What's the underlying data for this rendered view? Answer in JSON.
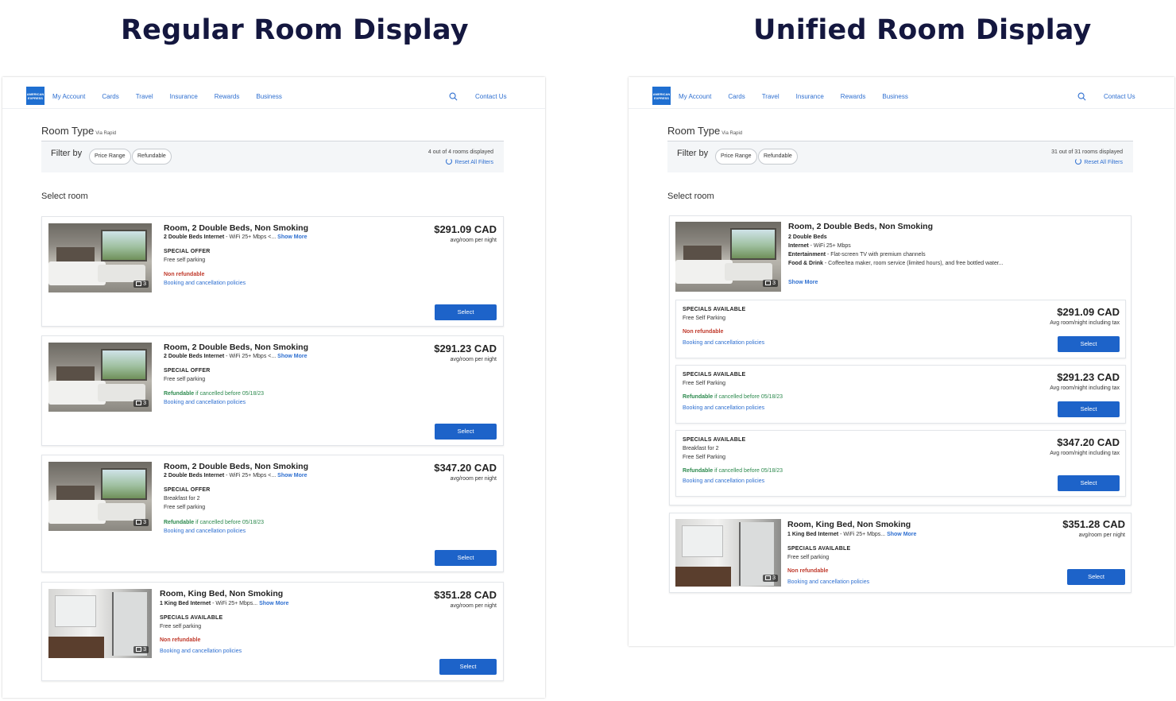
{
  "headings": {
    "left": "Regular Room Display",
    "right": "Unified Room Display"
  },
  "nav": {
    "logo_text": "AMERICAN EXPRESS",
    "links": [
      "My Account",
      "Cards",
      "Travel",
      "Insurance",
      "Rewards",
      "Business"
    ],
    "contact": "Contact Us"
  },
  "page": {
    "room_type": "Room Type",
    "via": "Via Rapid",
    "filter_by": "Filter by",
    "chips": [
      "Price Range",
      "Refundable"
    ],
    "reset": "Reset All Filters",
    "select_room": "Select room"
  },
  "regular": {
    "count": "4 out of 4 rooms displayed",
    "rooms": [
      {
        "title": "Room, 2 Double Beds, Non Smoking",
        "bed": "2 Double Beds Internet",
        "wifi": " - WiFi 25+ Mbps <...",
        "show_more": "Show More",
        "offer_label": "SPECIAL OFFER",
        "perks": [
          "Free self parking"
        ],
        "refund_bold": "Non refundable",
        "refund_rest": "",
        "policy": "Booking and cancellation policies",
        "price": "$291.09 CAD",
        "per": "avg/room per night",
        "button": "Select",
        "photos": "3"
      },
      {
        "title": "Room, 2 Double Beds, Non Smoking",
        "bed": "2 Double Beds Internet",
        "wifi": " - WiFi 25+ Mbps <...",
        "show_more": "Show More",
        "offer_label": "SPECIAL OFFER",
        "perks": [
          "Free self parking"
        ],
        "refund_bold": "Refundable",
        "refund_rest": " if cancelled before 05/18/23",
        "policy": "Booking and cancellation policies",
        "price": "$291.23 CAD",
        "per": "avg/room per night",
        "button": "Select",
        "photos": "3"
      },
      {
        "title": "Room, 2 Double Beds, Non Smoking",
        "bed": "2 Double Beds Internet",
        "wifi": " - WiFi 25+ Mbps <...",
        "show_more": "Show More",
        "offer_label": "SPECIAL OFFER",
        "perks": [
          "Breakfast for 2",
          "Free self parking"
        ],
        "refund_bold": "Refundable",
        "refund_rest": " if cancelled before 05/18/23",
        "policy": "Booking and cancellation policies",
        "price": "$347.20 CAD",
        "per": "avg/room per night",
        "button": "Select",
        "photos": "3"
      },
      {
        "title": "Room, King Bed, Non Smoking",
        "bed": "1 King Bed Internet",
        "wifi": " - WiFi 25+ Mbps...",
        "show_more": "Show More",
        "offer_label": "SPECIALS AVAILABLE",
        "perks": [
          "Free self parking"
        ],
        "refund_bold": "Non refundable",
        "refund_rest": "",
        "policy": "Booking and cancellation policies",
        "price": "$351.28 CAD",
        "per": "avg/room per night",
        "button": "Select",
        "photos": "3"
      }
    ]
  },
  "unified": {
    "count": "31 out of 31 rooms displayed",
    "group": {
      "title": "Room, 2 Double Beds, Non Smoking",
      "beds": "2 Double Beds",
      "internet_label": "Internet",
      "internet": " - WiFi 25+ Mbps",
      "entertainment_label": "Entertainment",
      "entertainment": " - Flat-screen TV with premium channels",
      "food_label": "Food & Drink",
      "food": " - Coffee/tea maker, room service (limited hours), and free bottled water...",
      "show_more": "Show More",
      "photos": "3",
      "offers": [
        {
          "label": "SPECIALS AVAILABLE",
          "perks": [
            "Free Self Parking"
          ],
          "refund_bold": "Non refundable",
          "refund_rest": "",
          "policy": "Booking and cancellation policies",
          "price": "$291.09 CAD",
          "per": "Avg room/night including tax",
          "button": "Select"
        },
        {
          "label": "SPECIALS AVAILABLE",
          "perks": [
            "Free Self Parking"
          ],
          "refund_bold": "Refundable",
          "refund_rest": " if cancelled before 05/18/23",
          "policy": "Booking and cancellation policies",
          "price": "$291.23 CAD",
          "per": "Avg room/night including tax",
          "button": "Select"
        },
        {
          "label": "SPECIALS AVAILABLE",
          "perks": [
            "Breakfast for 2",
            "Free Self Parking"
          ],
          "refund_bold": "Refundable",
          "refund_rest": " if cancelled before 05/18/23",
          "policy": "Booking and cancellation policies",
          "price": "$347.20 CAD",
          "per": "Avg room/night including tax",
          "button": "Select"
        }
      ]
    },
    "king": {
      "title": "Room, King Bed, Non Smoking",
      "bed": "1 King Bed Internet",
      "wifi": " - WiFi 25+ Mbps...",
      "show_more": "Show More",
      "offer_label": "SPECIALS AVAILABLE",
      "perk": "Free self parking",
      "refund_bold": "Non refundable",
      "policy": "Booking and cancellation policies",
      "price": "$351.28 CAD",
      "per": "avg/room per night",
      "button": "Select",
      "photos": "3"
    }
  },
  "colors": {
    "brand": "#1f6fd1",
    "button": "#1d63c9",
    "link": "#2e6fd0",
    "nonref": "#c0392b",
    "refund": "#2d8a4e",
    "heading": "#14173f"
  }
}
